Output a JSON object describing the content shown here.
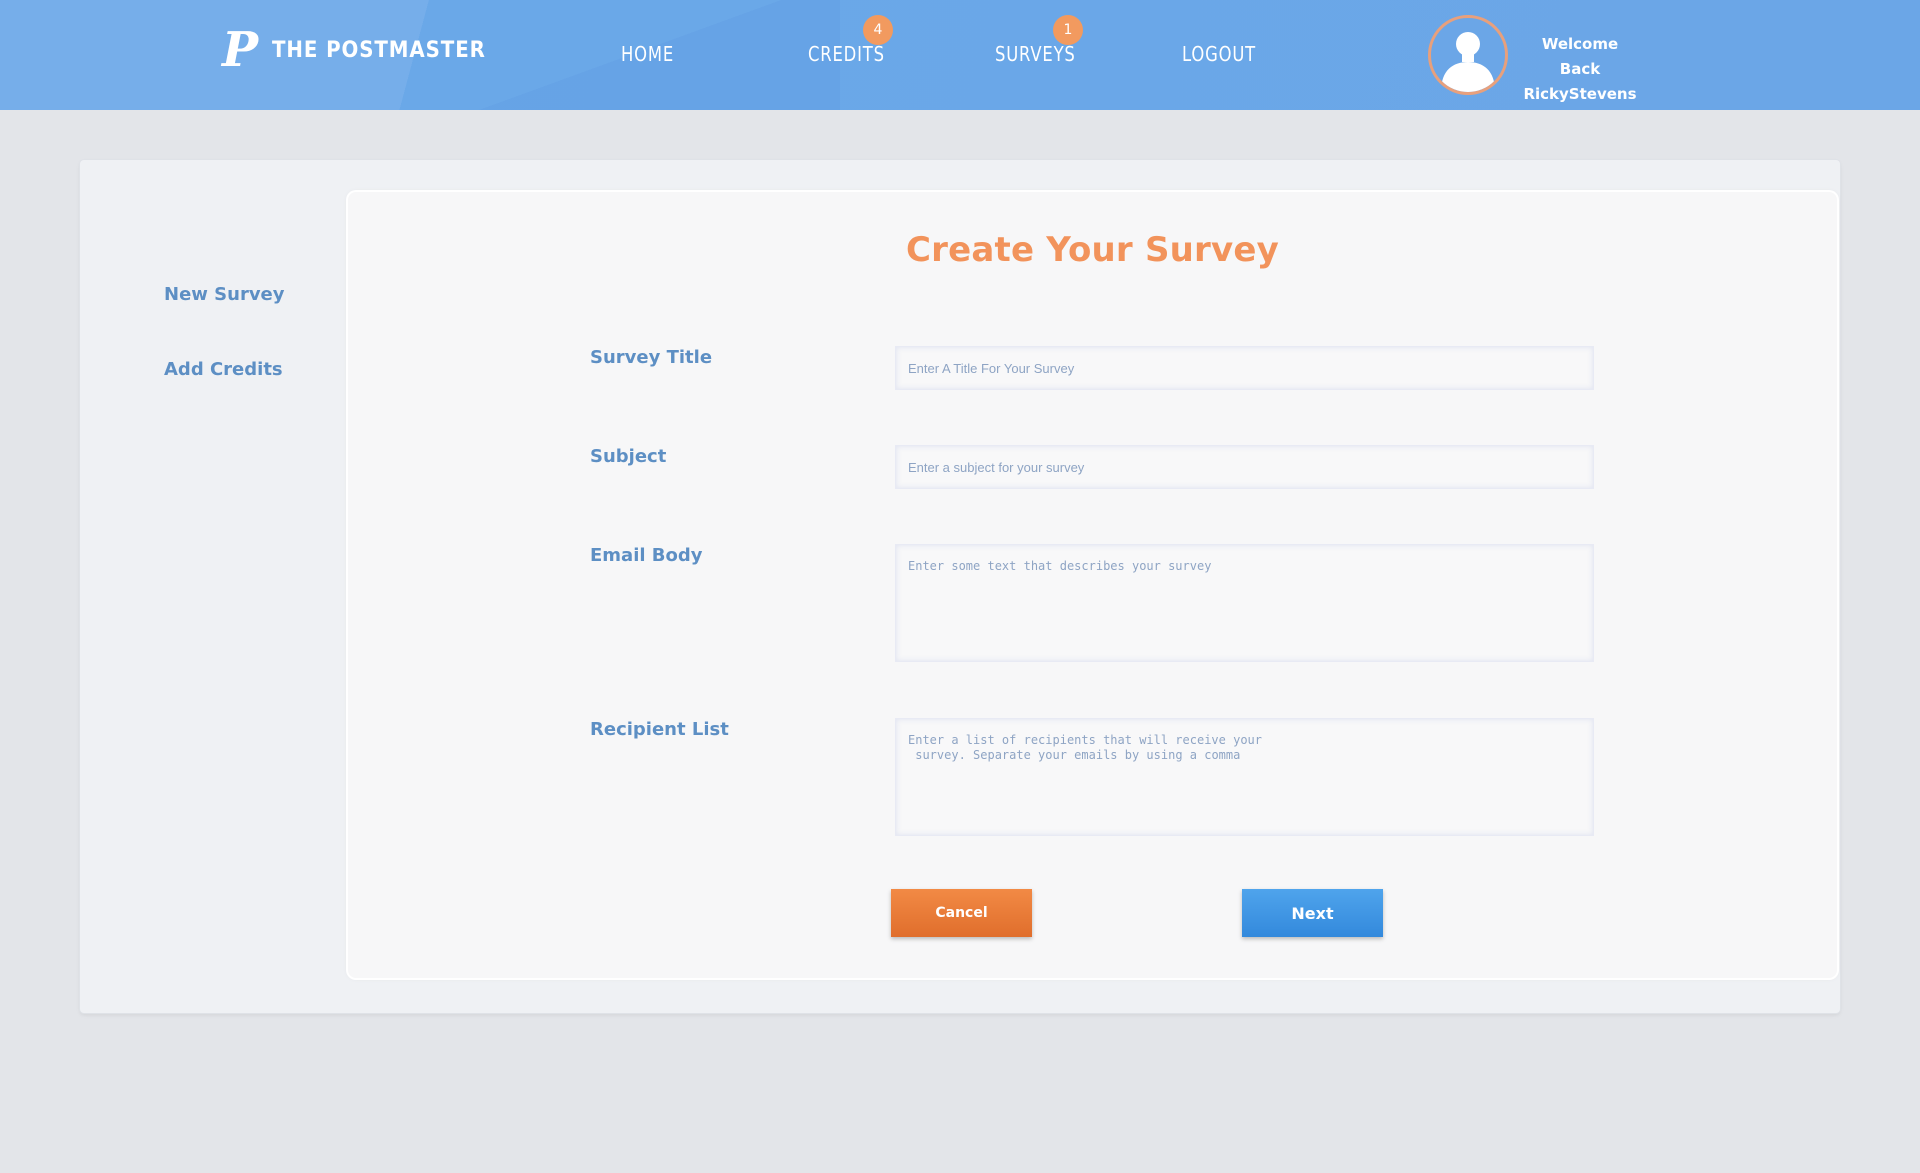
{
  "header": {
    "brand_logo": "P",
    "brand_name": "THE POSTMASTER",
    "nav": [
      {
        "label": "HOME"
      },
      {
        "label": "CREDITS",
        "badge": "4"
      },
      {
        "label": "SURVEYS",
        "badge": "1"
      },
      {
        "label": "LOGOUT"
      }
    ],
    "welcome_line1": "Welcome Back",
    "username": "RickyStevens",
    "avatar_icon": "user-silhouette-icon"
  },
  "sidebar": {
    "items": [
      {
        "label": "New Survey"
      },
      {
        "label": "Add Credits"
      }
    ]
  },
  "form": {
    "title": "Create Your Survey",
    "fields": [
      {
        "label": "Survey Title",
        "placeholder": "Enter A Title For Your Survey",
        "value": ""
      },
      {
        "label": "Subject",
        "placeholder": "Enter a subject for your survey",
        "value": ""
      },
      {
        "label": "Email Body",
        "placeholder": "Enter some text that describes your survey",
        "value": ""
      },
      {
        "label": "Recipient List",
        "placeholder": "Enter a list of recipients that will receive your\n survey. Separate your emails by using a comma",
        "value": ""
      }
    ],
    "cancel_label": "Cancel",
    "next_label": "Next"
  },
  "colors": {
    "header_blue": "#6ba6e7",
    "accent_orange": "#f2935b",
    "label_blue": "#5d8fc4",
    "next_blue": "#3f96e4",
    "cancel_orange": "#e97a37"
  }
}
